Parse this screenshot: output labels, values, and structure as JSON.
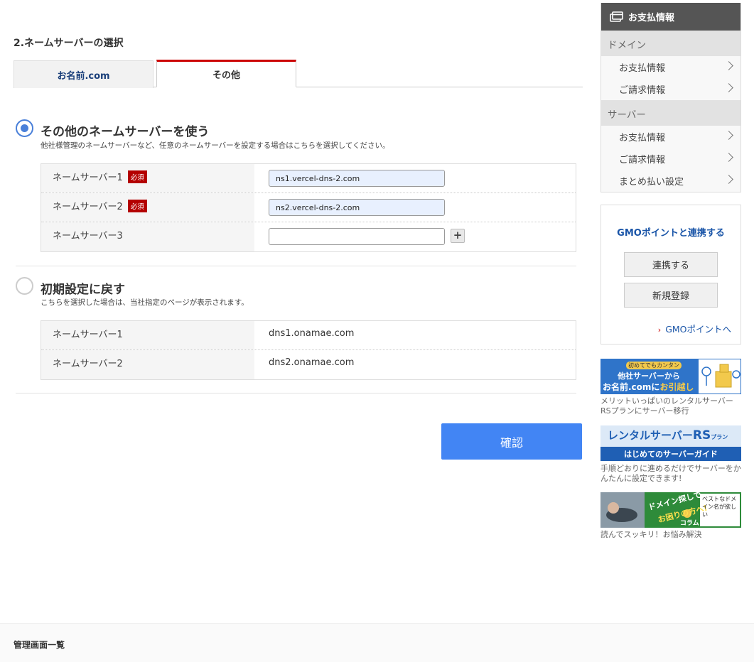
{
  "section": {
    "title": "2.ネームサーバーの選択"
  },
  "tabs": [
    {
      "label": "お名前.com"
    },
    {
      "label": "その他"
    }
  ],
  "option_other": {
    "title": "その他のネームサーバーを使う",
    "description": "他社様管理のネームサーバーなど、任意のネームサーバーを設定する場合はこちらを選択してください。",
    "required_label": "必須",
    "rows": [
      {
        "label": "ネームサーバー1",
        "value": "ns1.vercel-dns-2.com"
      },
      {
        "label": "ネームサーバー2",
        "value": "ns2.vercel-dns-2.com"
      },
      {
        "label": "ネームサーバー3",
        "value": ""
      }
    ],
    "add_label": "+"
  },
  "option_default": {
    "title": "初期設定に戻す",
    "description": "こちらを選択した場合は、当社指定のページが表示されます。",
    "rows": [
      {
        "label": "ネームサーバー1",
        "value": "dns1.onamae.com"
      },
      {
        "label": "ネームサーバー2",
        "value": "dns2.onamae.com"
      }
    ]
  },
  "confirm_label": "確認",
  "sidebar": {
    "header": "お支払情報",
    "groups": [
      {
        "category": "ドメイン",
        "items": [
          "お支払情報",
          "ご請求情報"
        ]
      },
      {
        "category": "サーバー",
        "items": [
          "お支払情報",
          "ご請求情報",
          "まとめ払い設定"
        ]
      }
    ]
  },
  "gmo": {
    "title": "GMOポイントと連携する",
    "link_button": "連携する",
    "register_button": "新規登録",
    "point_link": "GMOポイントへ"
  },
  "banners": [
    {
      "badge": "初めてでもカンタン",
      "line1": "他社サーバーから",
      "line2a": "お名前.comに",
      "line2b": "お引越し",
      "caption": "メリットいっぱいのレンタルサーバーRSプランにサーバー移行"
    },
    {
      "title": "レンタルサーバーRSプラン",
      "title_main": "レンタルサーバー",
      "title_rs": "RS",
      "title_plan": "プラン",
      "subtitle": "はじめてのサーバーガイド",
      "caption": "手順どおりに進めるだけでサーバーをかんたんに設定できます!"
    },
    {
      "line1": "ドメイン探しで",
      "line2": "お困りの方へ!",
      "tag": "コラム",
      "note": "ベストなドメイン名が欲しい",
      "caption": "読んでスッキリ！お悩み解決"
    }
  ],
  "footer": {
    "label": "管理画面一覧"
  },
  "colors": {
    "accent": "#4285f4",
    "required": "#b40000",
    "tab_active_border": "#cc0000",
    "link": "#1a55a8"
  }
}
